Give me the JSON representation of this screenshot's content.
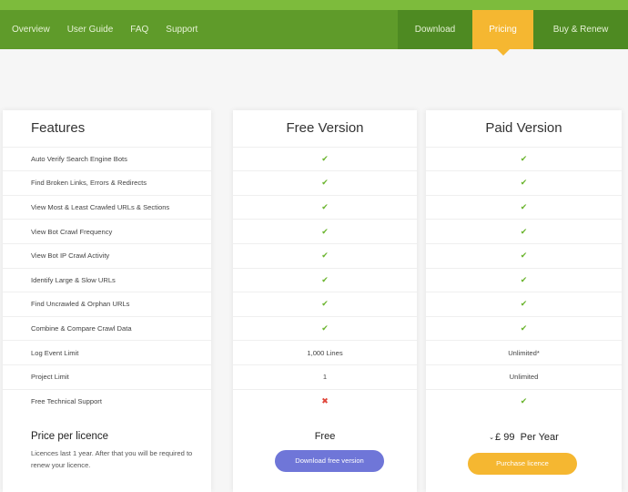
{
  "nav": {
    "left": [
      "Overview",
      "User Guide",
      "FAQ",
      "Support"
    ],
    "download": "Download",
    "pricing": "Pricing",
    "buy": "Buy & Renew"
  },
  "columns": {
    "features": "Features",
    "free": "Free Version",
    "paid": "Paid Version"
  },
  "rows": [
    {
      "feature": "Auto Verify Search Engine Bots",
      "free": "check",
      "paid": "check"
    },
    {
      "feature": "Find Broken Links, Errors & Redirects",
      "free": "check",
      "paid": "check"
    },
    {
      "feature": "View Most & Least Crawled URLs & Sections",
      "free": "check",
      "paid": "check"
    },
    {
      "feature": "View Bot Crawl Frequency",
      "free": "check",
      "paid": "check"
    },
    {
      "feature": "View Bot IP Crawl Activity",
      "free": "check",
      "paid": "check"
    },
    {
      "feature": "Identify Large & Slow URLs",
      "free": "check",
      "paid": "check"
    },
    {
      "feature": "Find Uncrawled & Orphan URLs",
      "free": "check",
      "paid": "check"
    },
    {
      "feature": "Combine & Compare Crawl Data",
      "free": "check",
      "paid": "check"
    },
    {
      "feature": "Log Event Limit",
      "free": "1,000 Lines",
      "paid": "Unlimited*"
    },
    {
      "feature": "Project Limit",
      "free": "1",
      "paid": "Unlimited"
    },
    {
      "feature": "Free Technical Support",
      "free": "cross",
      "paid": "check"
    }
  ],
  "pricing": {
    "label": "Price per licence",
    "note": "Licences last 1 year. After that you will be required to renew your licence.",
    "free_price": "Free",
    "free_button": "Download free version",
    "currency": "£",
    "amount": "99",
    "period": "Per Year",
    "paid_button": "Purchase licence"
  },
  "colors": {
    "nav_bg": "#5f9b2a",
    "accent": "#f5b731",
    "check": "#6ab42d",
    "cross": "#e0463a",
    "free_button": "#6f76d8"
  }
}
